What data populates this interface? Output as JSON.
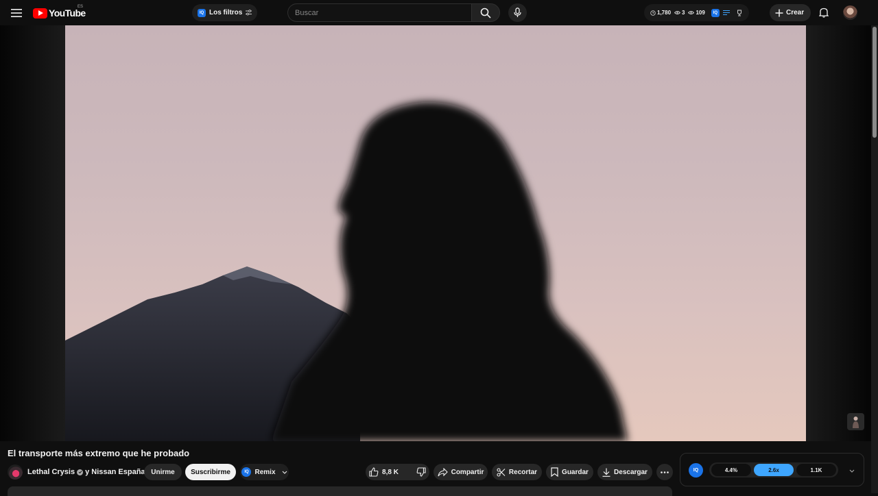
{
  "header": {
    "brand": "YouTube",
    "country": "ES",
    "filters_label": "Los filtros",
    "iq_badge": "IQ",
    "search": {
      "placeholder": "Buscar",
      "value": ""
    },
    "stats": [
      {
        "icon": "clock-icon",
        "value": "1,780"
      },
      {
        "icon": "eye-icon",
        "value": "3"
      },
      {
        "icon": "eye-icon",
        "value": "109"
      }
    ],
    "create_label": "Crear"
  },
  "video": {
    "title": "El transporte más extremo que he probado",
    "channel": "Lethal Crysis",
    "collab": "y Nissan España",
    "join_label": "Unirme",
    "subscribe_label": "Suscribirme",
    "remix_label": "Remix",
    "likes": "8,8 K",
    "share_label": "Compartir",
    "clip_label": "Recortar",
    "save_label": "Guardar",
    "download_label": "Descargar"
  },
  "iq_panel": {
    "badge": "IQ",
    "metrics": [
      {
        "value": "4.4%",
        "active": false
      },
      {
        "value": "2.6x",
        "active": true
      },
      {
        "value": "1.1K",
        "active": false
      }
    ]
  },
  "colors": {
    "brand_red": "#ff0000",
    "accent_blue": "#3ea6ff",
    "iq_blue": "#1a73e8",
    "background": "#0f0f0f"
  }
}
